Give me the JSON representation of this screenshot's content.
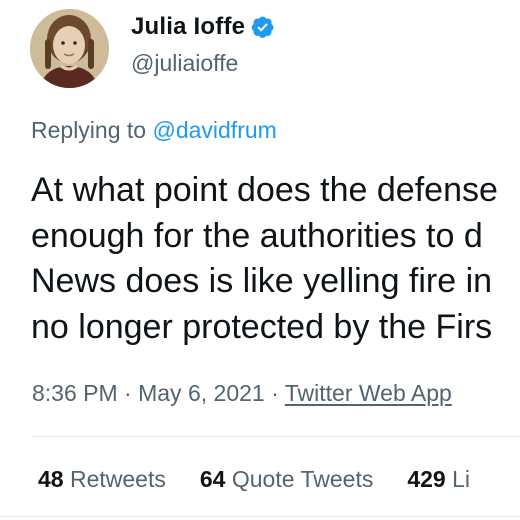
{
  "author": {
    "display_name": "Julia Ioffe",
    "handle": "@juliaioffe",
    "verified": true
  },
  "reply": {
    "prefix": "Replying to",
    "mention": "@davidfrum"
  },
  "tweet": {
    "lines": [
      "At what point does the defense",
      "enough for the authorities to d",
      "News does is like yelling fire in",
      "no longer protected by the Firs"
    ]
  },
  "meta": {
    "time": "8:36 PM",
    "separator": "·",
    "date": "May 6, 2021",
    "source": "Twitter Web App"
  },
  "stats": {
    "retweets": {
      "count": "48",
      "label": "Retweets"
    },
    "quotes": {
      "count": "64",
      "label": "Quote Tweets"
    },
    "likes": {
      "count": "429",
      "label": "Li"
    }
  },
  "colors": {
    "verified_blue": "#1d9bf0",
    "mention_blue": "#1d9bf0",
    "secondary_text": "#536471"
  }
}
